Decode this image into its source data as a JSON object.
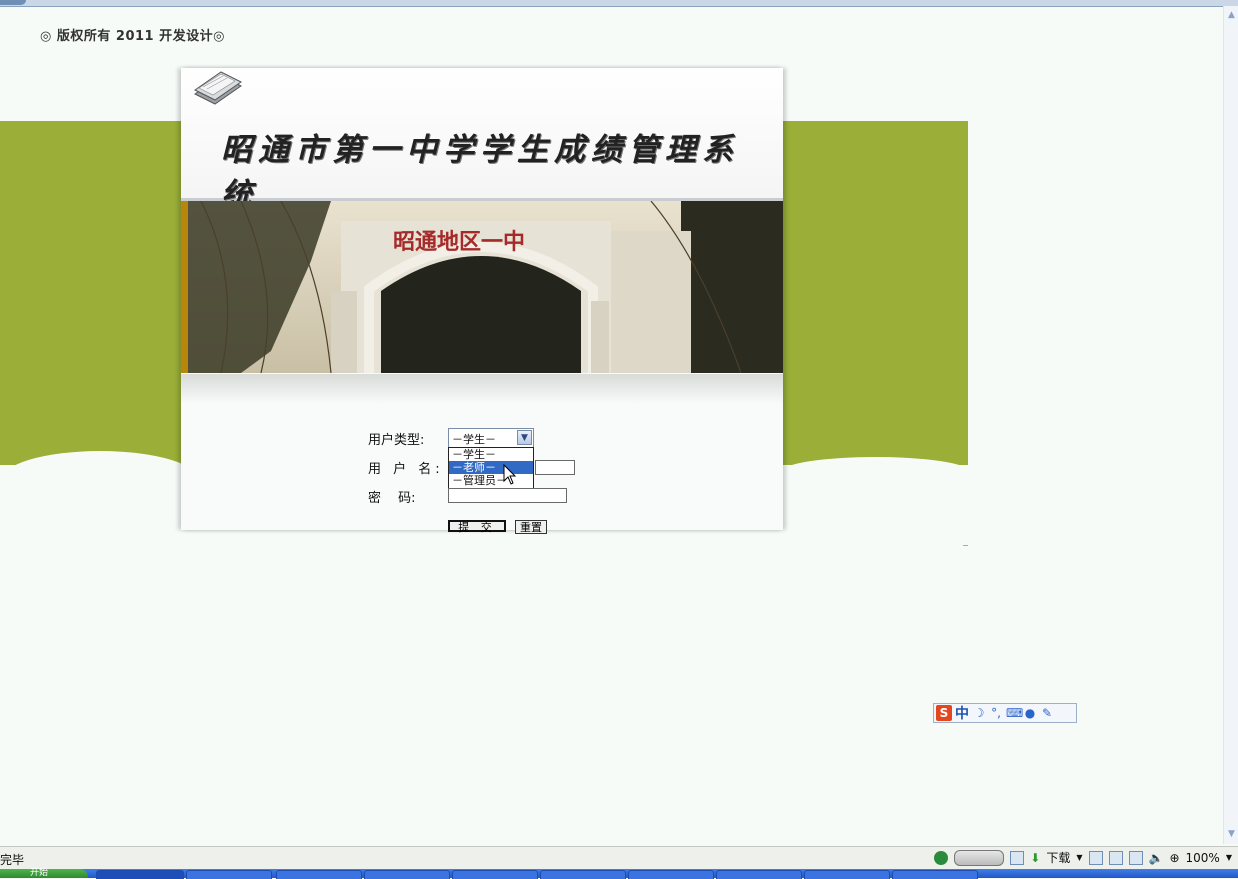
{
  "page": {
    "copyright": "◎ 版权所有 2011 开发设计◎",
    "system_title": "昭通市第一中学学生成绩管理系统",
    "photo_sign": "昭通地区一中"
  },
  "form": {
    "user_type_label": "用户类型:",
    "username_label": "用 户 名:",
    "password_label": "密　 码:",
    "user_type_selected": "－学生－",
    "user_type_options": [
      "－学生－",
      "－老师－",
      "－管理员－"
    ],
    "highlighted_option_index": 1,
    "username_value": "",
    "password_value": "",
    "submit_label": "提 交",
    "reset_label": "重置"
  },
  "ime_toolbar": {
    "logo": "S",
    "mode": "中",
    "icons": [
      "moon-icon",
      "punctuation-icon",
      "keyboard-icon",
      "user-icon",
      "wrench-icon"
    ]
  },
  "statusbar": {
    "status_text": "完毕",
    "download_label": "下载",
    "zoom": "100%"
  },
  "taskbar": {
    "start_label": "开始"
  },
  "colors": {
    "green_band": "#9aae38",
    "selection": "#316ac5",
    "page_bg": "#f6fbf8"
  }
}
